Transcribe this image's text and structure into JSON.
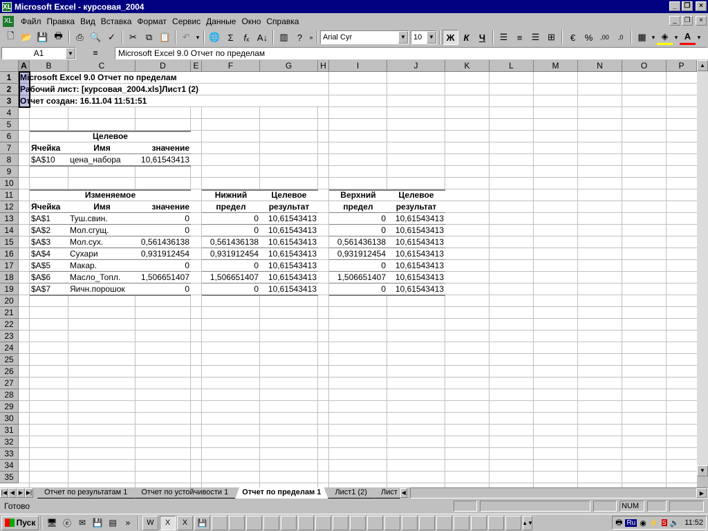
{
  "window": {
    "title": "Microsoft Excel - курсовая_2004",
    "app_icon": "XL",
    "minimize": "_",
    "restore": "❐",
    "close": "×"
  },
  "menu": [
    "Файл",
    "Правка",
    "Вид",
    "Вставка",
    "Формат",
    "Сервис",
    "Данные",
    "Окно",
    "Справка"
  ],
  "font": {
    "name": "Arial Cyr",
    "size": "10"
  },
  "toolbar_icons": [
    "new-icon",
    "open-icon",
    "save-icon",
    "permission-icon",
    "print-icon",
    "print-preview-icon",
    "spelling-icon",
    "cut-icon",
    "copy-icon",
    "paste-icon",
    "undo-icon",
    "hyperlink-icon",
    "autosum-icon",
    "function-icon",
    "sort-icon",
    "chart-wizard-icon",
    "help-icon"
  ],
  "formula_bar": {
    "name_box": "A1",
    "equals": "=",
    "content": "Microsoft Excel 9.0 Отчет по пределам"
  },
  "columns": [
    "A",
    "B",
    "C",
    "D",
    "E",
    "F",
    "G",
    "H",
    "I",
    "J",
    "K",
    "L",
    "M",
    "N",
    "O",
    "P"
  ],
  "rows": [
    "1",
    "2",
    "3",
    "4",
    "5",
    "6",
    "7",
    "8",
    "9",
    "10",
    "11",
    "12",
    "13",
    "14",
    "15",
    "16",
    "17",
    "18",
    "19",
    "20",
    "21",
    "22",
    "23",
    "24",
    "25",
    "26",
    "27",
    "28",
    "29",
    "30",
    "31",
    "32",
    "33",
    "34",
    "35"
  ],
  "report": {
    "header1": "Microsoft Excel 9.0 Отчет по пределам",
    "header2": "Рабочий лист: [курсовая_2004.xls]Лист1 (2)",
    "header3": "Отчет создан: 16.11.04 11:51:51",
    "target": {
      "h_top": "Целевое",
      "h_cell": "Ячейка",
      "h_name": "Имя",
      "h_value": "значение",
      "cell": "$A$10",
      "name": "цена_набора",
      "value": "10,61543413"
    },
    "adjustable_headers": {
      "h_top": "Изменяемое",
      "h_cell": "Ячейка",
      "h_name": "Имя",
      "h_value": "значение",
      "lower_top": "Нижний",
      "lower_bottom": "предел",
      "lower_target_top": "Целевое",
      "lower_target_bottom": "результат",
      "upper_top": "Верхний",
      "upper_bottom": "предел",
      "upper_target_top": "Целевое",
      "upper_target_bottom": "результат"
    },
    "adjustable": [
      {
        "cell": "$A$1",
        "name": "Туш.свин.",
        "value": "0",
        "lower": "0",
        "lower_target": "10,61543413",
        "upper": "0",
        "upper_target": "10,61543413"
      },
      {
        "cell": "$A$2",
        "name": "Мол.сгущ.",
        "value": "0",
        "lower": "0",
        "lower_target": "10,61543413",
        "upper": "0",
        "upper_target": "10,61543413"
      },
      {
        "cell": "$A$3",
        "name": "Мол.сух.",
        "value": "0,561436138",
        "lower": "0,561436138",
        "lower_target": "10,61543413",
        "upper": "0,561436138",
        "upper_target": "10,61543413"
      },
      {
        "cell": "$A$4",
        "name": "Сухари",
        "value": "0,931912454",
        "lower": "0,931912454",
        "lower_target": "10,61543413",
        "upper": "0,931912454",
        "upper_target": "10,61543413"
      },
      {
        "cell": "$A$5",
        "name": "Макар.",
        "value": "0",
        "lower": "0",
        "lower_target": "10,61543413",
        "upper": "0",
        "upper_target": "10,61543413"
      },
      {
        "cell": "$A$6",
        "name": "Масло_Топл.",
        "value": "1,506651407",
        "lower": "1,506651407",
        "lower_target": "10,61543413",
        "upper": "1,506651407",
        "upper_target": "10,61543413"
      },
      {
        "cell": "$A$7",
        "name": "Яичн.порошок",
        "value": "0",
        "lower": "0",
        "lower_target": "10,61543413",
        "upper": "0",
        "upper_target": "10,61543413"
      }
    ]
  },
  "sheet_tabs": [
    "Отчет по результатам 1",
    "Отчет по устойчивости 1",
    "Отчет по пределам 1",
    "Лист1 (2)",
    "Лист"
  ],
  "active_tab": "Отчет по пределам 1",
  "status": {
    "text": "Готово",
    "num": "NUM"
  },
  "taskbar": {
    "start": "Пуск",
    "lang": "Ru",
    "clock": "11:52"
  }
}
